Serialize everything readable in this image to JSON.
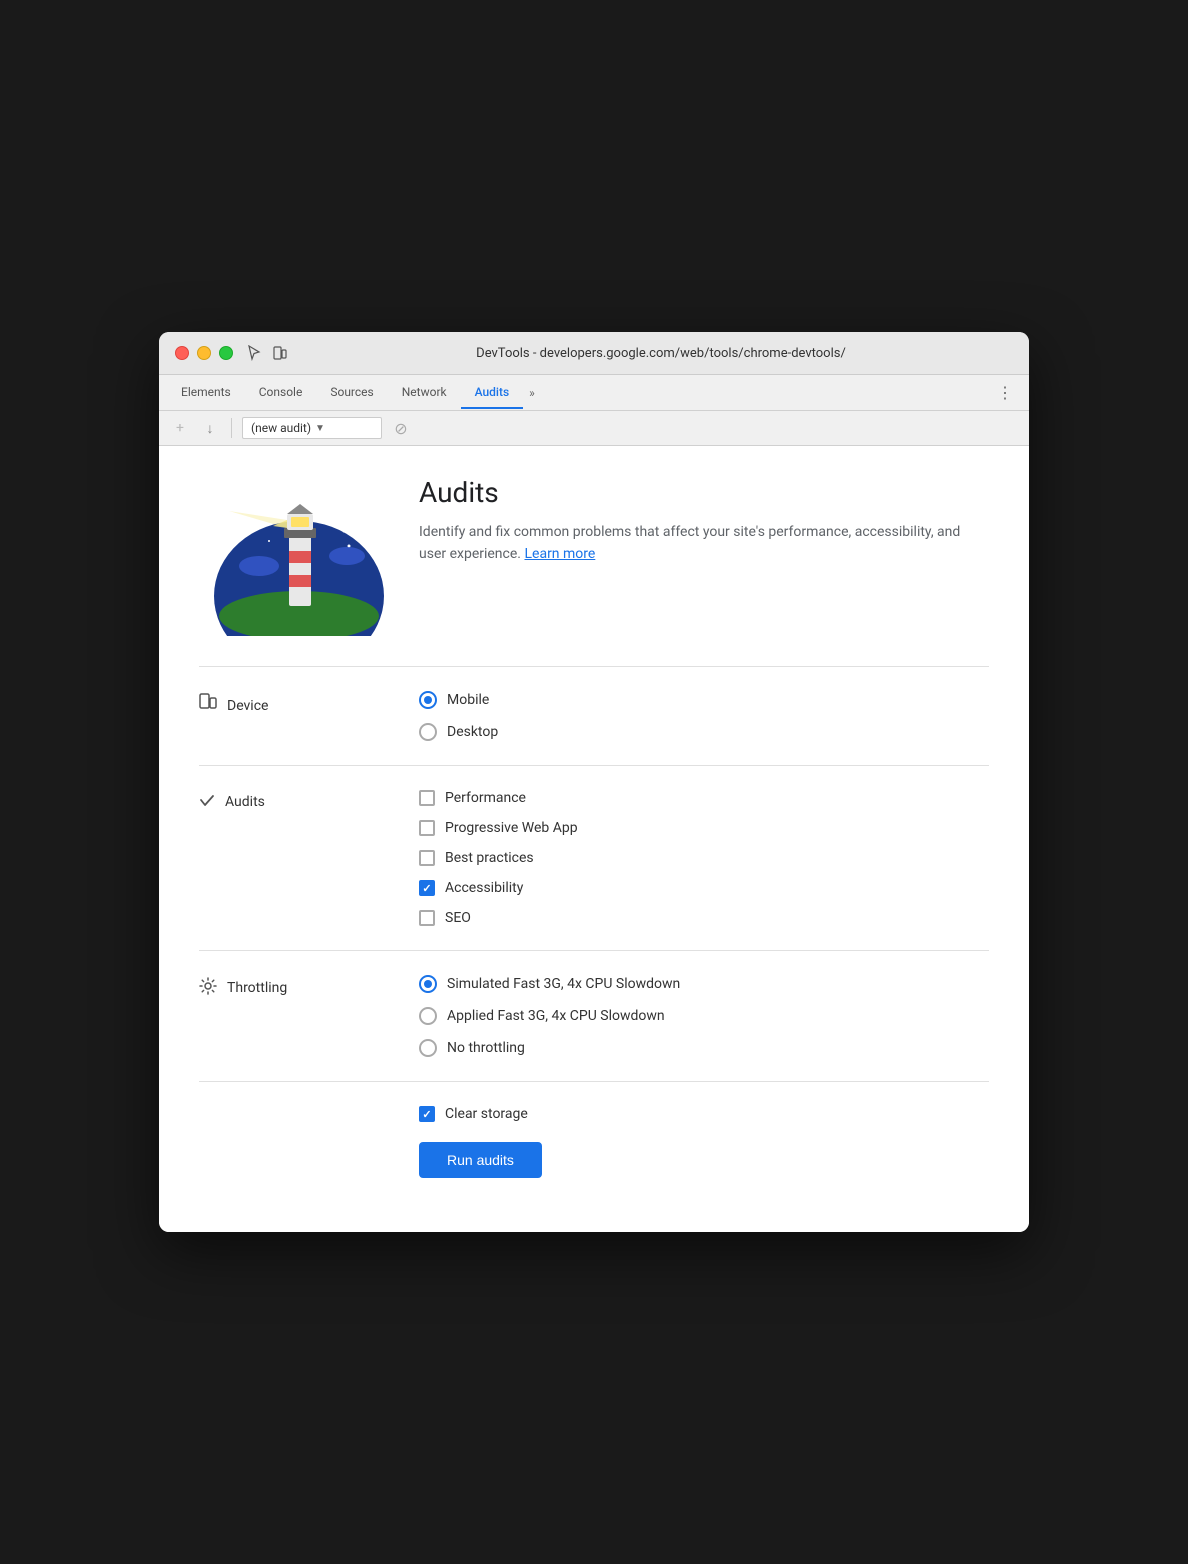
{
  "window": {
    "title": "DevTools - developers.google.com/web/tools/chrome-devtools/"
  },
  "tabs": {
    "items": [
      {
        "label": "Elements",
        "active": false
      },
      {
        "label": "Console",
        "active": false
      },
      {
        "label": "Sources",
        "active": false
      },
      {
        "label": "Network",
        "active": false
      },
      {
        "label": "Audits",
        "active": true
      }
    ],
    "more_label": "»",
    "menu_label": "⋮"
  },
  "audit_toolbar": {
    "add_label": "+",
    "download_label": "↓",
    "dropdown_value": "(new audit)",
    "dropdown_arrow": "▼",
    "cancel_label": "⊘"
  },
  "hero": {
    "title": "Audits",
    "description": "Identify and fix common problems that affect your site's performance, accessibility, and user experience.",
    "learn_more_label": "Learn more"
  },
  "device_section": {
    "icon": "📱",
    "label": "Device",
    "options": [
      {
        "label": "Mobile",
        "checked": true
      },
      {
        "label": "Desktop",
        "checked": false
      }
    ]
  },
  "audits_section": {
    "label": "Audits",
    "options": [
      {
        "label": "Performance",
        "checked": false
      },
      {
        "label": "Progressive Web App",
        "checked": false
      },
      {
        "label": "Best practices",
        "checked": false
      },
      {
        "label": "Accessibility",
        "checked": true
      },
      {
        "label": "SEO",
        "checked": false
      }
    ]
  },
  "throttling_section": {
    "label": "Throttling",
    "options": [
      {
        "label": "Simulated Fast 3G, 4x CPU Slowdown",
        "checked": true
      },
      {
        "label": "Applied Fast 3G, 4x CPU Slowdown",
        "checked": false
      },
      {
        "label": "No throttling",
        "checked": false
      }
    ]
  },
  "bottom_section": {
    "clear_storage_label": "Clear storage",
    "clear_storage_checked": true,
    "run_button_label": "Run audits"
  }
}
